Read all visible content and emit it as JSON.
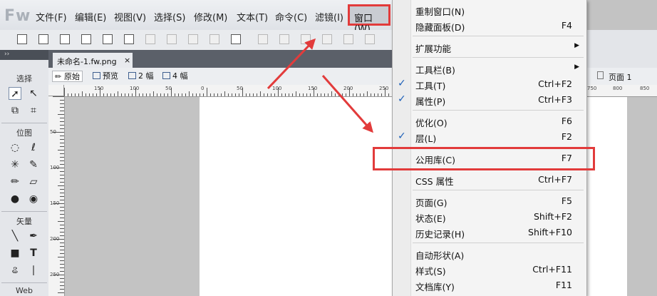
{
  "app": {
    "logo": "Fw"
  },
  "menubar": {
    "items": [
      "文件(F)",
      "编辑(E)",
      "视图(V)",
      "选择(S)",
      "修改(M)",
      "文本(T)",
      "命令(C)",
      "滤镜(I)"
    ],
    "active": "窗口(W)"
  },
  "document": {
    "tab_title": "未命名-1.fw.png",
    "close": "×"
  },
  "viewbar": {
    "original": "原始",
    "preview": "预览",
    "two_up": "2 幅",
    "four_up": "4 幅"
  },
  "right_panel": {
    "pages_label": "页面 1"
  },
  "tools": {
    "select": "选择",
    "bitmap": "位图",
    "vector": "矢量",
    "web": "Web",
    "text_tool": "T"
  },
  "ruler_h": [
    "150",
    "100",
    "50",
    "0",
    "50",
    "100",
    "150",
    "200",
    "250"
  ],
  "ruler_v": [
    "50",
    "100",
    "150",
    "200",
    "250"
  ],
  "ruler_right": [
    "750",
    "800",
    "850"
  ],
  "window_menu": [
    {
      "label": "重制窗口(N)",
      "shortcut": "",
      "checked": false,
      "submenu": false,
      "sep_after": false
    },
    {
      "label": "隐藏面板(D)",
      "shortcut": "F4",
      "checked": false,
      "submenu": false,
      "sep_after": true
    },
    {
      "label": "扩展功能",
      "shortcut": "",
      "checked": false,
      "submenu": true,
      "sep_after": true
    },
    {
      "label": "工具栏(B)",
      "shortcut": "",
      "checked": false,
      "submenu": true,
      "sep_after": false
    },
    {
      "label": "工具(T)",
      "shortcut": "Ctrl+F2",
      "checked": true,
      "submenu": false,
      "sep_after": false
    },
    {
      "label": "属性(P)",
      "shortcut": "Ctrl+F3",
      "checked": true,
      "submenu": false,
      "sep_after": true
    },
    {
      "label": "优化(O)",
      "shortcut": "F6",
      "checked": false,
      "submenu": false,
      "sep_after": false
    },
    {
      "label": "层(L)",
      "shortcut": "F2",
      "checked": true,
      "submenu": false,
      "sep_after": true
    },
    {
      "label": "公用库(C)",
      "shortcut": "F7",
      "checked": false,
      "submenu": false,
      "sep_after": true
    },
    {
      "label": "CSS 属性",
      "shortcut": "Ctrl+F7",
      "checked": false,
      "submenu": false,
      "sep_after": true
    },
    {
      "label": "页面(G)",
      "shortcut": "F5",
      "checked": false,
      "submenu": false,
      "sep_after": false
    },
    {
      "label": "状态(E)",
      "shortcut": "Shift+F2",
      "checked": false,
      "submenu": false,
      "sep_after": false
    },
    {
      "label": "历史记录(H)",
      "shortcut": "Shift+F10",
      "checked": false,
      "submenu": false,
      "sep_after": true
    },
    {
      "label": "自动形状(A)",
      "shortcut": "",
      "checked": false,
      "submenu": false,
      "sep_after": false
    },
    {
      "label": "样式(S)",
      "shortcut": "Ctrl+F11",
      "checked": false,
      "submenu": false,
      "sep_after": false
    },
    {
      "label": "文档库(Y)",
      "shortcut": "F11",
      "checked": false,
      "submenu": false,
      "sep_after": false
    }
  ],
  "colors": {
    "highlight": "#e23b3b",
    "check": "#1c5fb8"
  }
}
